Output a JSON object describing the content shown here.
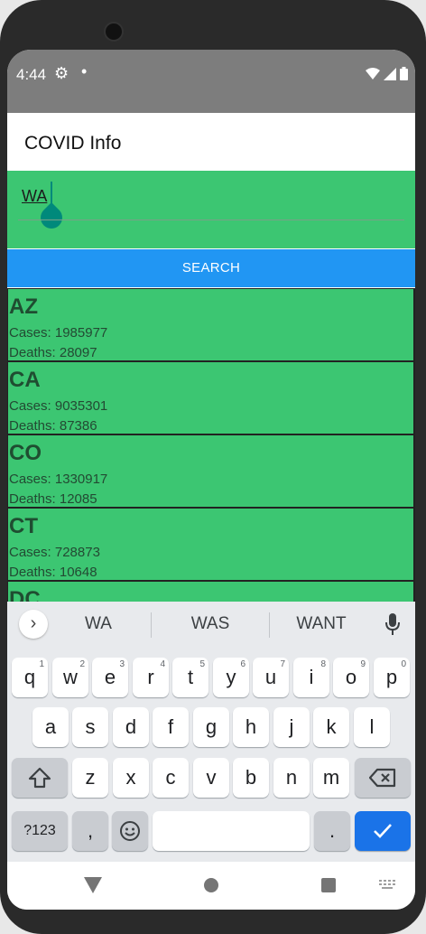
{
  "status": {
    "time": "4:44"
  },
  "appbar": {
    "title": "COVID Info"
  },
  "search": {
    "value": "WA",
    "button_label": "SEARCH"
  },
  "states": [
    {
      "code": "AZ",
      "cases": "Cases: 1985977",
      "deaths": "Deaths: 28097"
    },
    {
      "code": "CA",
      "cases": "Cases: 9035301",
      "deaths": "Deaths: 87386"
    },
    {
      "code": "CO",
      "cases": "Cases: 1330917",
      "deaths": "Deaths: 12085"
    },
    {
      "code": "CT",
      "cases": "Cases: 728873",
      "deaths": "Deaths: 10648"
    },
    {
      "code": "DC",
      "cases": "",
      "deaths": ""
    }
  ],
  "keyboard": {
    "suggestions": [
      "WA",
      "WAS",
      "WANT"
    ],
    "row1": [
      "q",
      "w",
      "e",
      "r",
      "t",
      "y",
      "u",
      "i",
      "o",
      "p"
    ],
    "row1_hints": [
      "1",
      "2",
      "3",
      "4",
      "5",
      "6",
      "7",
      "8",
      "9",
      "0"
    ],
    "row2": [
      "a",
      "s",
      "d",
      "f",
      "g",
      "h",
      "j",
      "k",
      "l"
    ],
    "row3": [
      "z",
      "x",
      "c",
      "v",
      "b",
      "n",
      "m"
    ],
    "symbols_label": "?123",
    "comma_label": ",",
    "period_label": "."
  },
  "icons": {
    "settings": "gear-icon",
    "wifi": "wifi-icon",
    "signal": "signal-icon",
    "battery": "battery-icon",
    "mic": "mic-icon",
    "shift": "shift-icon",
    "backspace": "backspace-icon",
    "emoji": "emoji-icon",
    "enter": "check-icon",
    "back": "nav-back-icon",
    "home": "nav-home-icon",
    "recents": "nav-recents-icon"
  }
}
